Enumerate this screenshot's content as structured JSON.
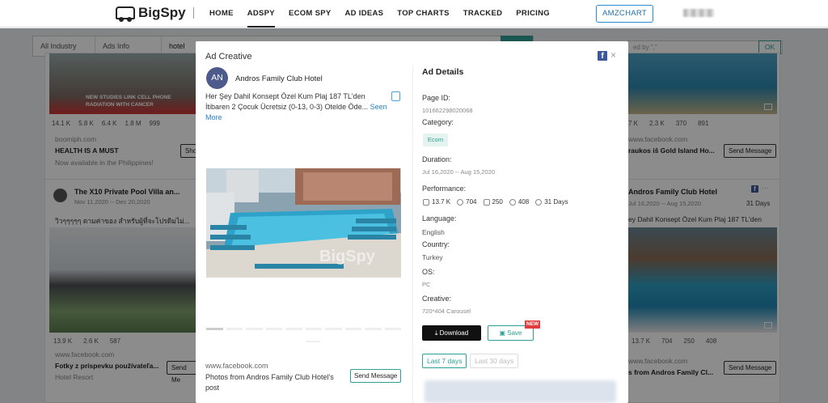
{
  "nav": {
    "logo": "BigSpy",
    "items": [
      "HOME",
      "ADSPY",
      "ECOM SPY",
      "AD IDEAS",
      "TOP CHARTS",
      "TRACKED",
      "PRICING"
    ],
    "active": "ADSPY",
    "amzchart": "AMZCHART"
  },
  "search": {
    "industry": "All Industry",
    "ads_info": "Ads Info",
    "query": "hotel",
    "right_placeholder": "ed by \",\"",
    "ok": "OK"
  },
  "cards": {
    "c1": {
      "stats": [
        "14.1 K",
        "5.8 K",
        "6.4 K",
        "1.8 M",
        "999"
      ],
      "domain": "boomiph.com",
      "headline": "HEALTH IS A MUST",
      "sub": "Now available in the Philippines!",
      "btn": "Shop",
      "thumb_text": "NEW STUDIES LINK CELL PHONE RADIATION WITH CANCER"
    },
    "c2": {
      "title": "The X10 Private Pool Villa an...",
      "dates": "Nov 11,2020 -- Dec 20,2020",
      "text": "วิวๆๆๆๆๆ ตามค่าของ สำหรับผู้ที่จะโปรดิมไม่...",
      "stats": [
        "13.9 K",
        "2.6 K",
        "587"
      ],
      "domain": "www.facebook.com",
      "headline": "Fotky z príspevku používateľa...",
      "sub": "Hotel Resort",
      "btn": "Send Me"
    },
    "c3": {
      "stats": [
        "7 K",
        "2.3 K",
        "370",
        "891"
      ],
      "domain": "www.facebook.com",
      "headline": "raukos iš Gold Island Ho...",
      "btn": "Send Message"
    },
    "c4": {
      "title": "Andros Family Club Hotel",
      "dates": "Jul 16,2020 -- Aug 15,2020",
      "days": "31 Days",
      "text": "ey Dahil Konsept Özel Kum Plaj 187 TL'den",
      "stats": [
        "13.7 K",
        "704",
        "250",
        "408"
      ],
      "domain": "www.facebook.com",
      "headline": "s from Andros Family Cl...",
      "btn": "Send Message"
    }
  },
  "modal": {
    "title": "Ad Creative",
    "avatar": "AN",
    "advertiser": "Andros Family Club Hotel",
    "text": "Her Şey Dahil Konsept Özel Kum Plaj 187 TL'den İtibaren 2 Çocuk Ücretsiz (0-13, 0-3) Otelde Öde... ",
    "see_more": "Seen More",
    "watermark": "BigSpy",
    "domain": "www.facebook.com",
    "cta_text": "Photos from Andros Family Club Hotel's post",
    "cta_button": "Send Message",
    "details_title": "Ad Details",
    "page_id_label": "Page ID:",
    "page_id": "101662298020068",
    "category_label": "Category:",
    "category": "Ecom",
    "duration_label": "Duration:",
    "duration": "Jul 16,2020 -- Aug 15,2020",
    "performance_label": "Performance:",
    "performance": {
      "likes": "13.7 K",
      "comments": "704",
      "shares": "250",
      "views": "408",
      "days": "31 Days"
    },
    "language_label": "Language:",
    "language": "English",
    "country_label": "Country:",
    "country": "Turkey",
    "os_label": "OS:",
    "os": "PC",
    "creative_label": "Creative:",
    "creative": "720*404 Carousel",
    "download": "Download",
    "save": "Save",
    "new_badge": "NEW",
    "tab_7": "Last 7 days",
    "tab_30": "Last 30 days"
  },
  "colors": {
    "accent": "#2e9f92",
    "link": "#2a7ec8",
    "facebook": "#3b5998",
    "new": "#e43d3d"
  }
}
